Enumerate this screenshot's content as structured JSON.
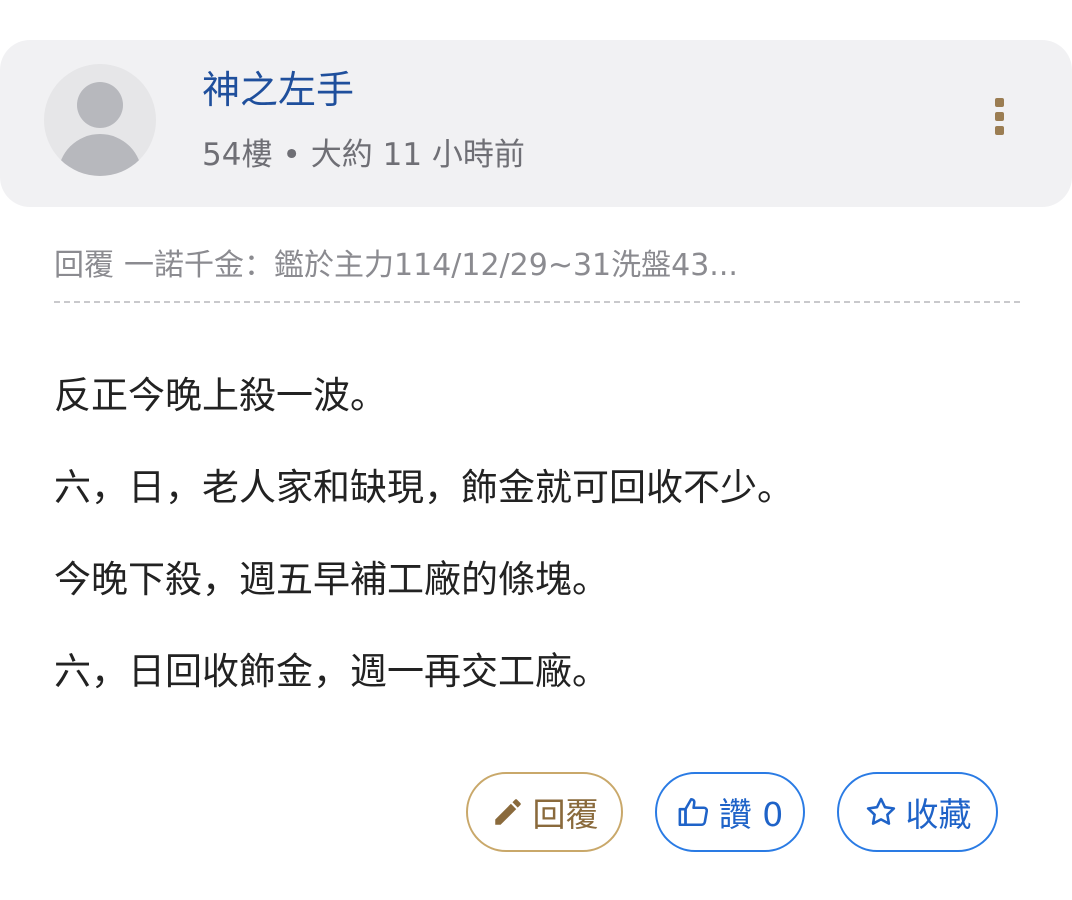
{
  "post": {
    "author": "神之左手",
    "floor": "54樓",
    "meta_separator": "•",
    "time": "大約 11 小時前",
    "quote_prefix": "回覆",
    "quote_text": "一諾千金：鑑於主力114/12/29~31洗盤43...",
    "content_lines": [
      "反正今晚上殺一波。",
      "六，日，老人家和缺現，飾金就可回收不少。",
      "今晚下殺，週五早補工廠的條塊。",
      "六，日回收飾金，週一再交工廠。"
    ]
  },
  "actions": {
    "reply_label": "回覆",
    "like_label": "讚 0",
    "favorite_label": "收藏"
  },
  "icons": {
    "avatar": "default-avatar-icon",
    "more": "more-vertical-icon",
    "reply": "pencil-icon",
    "like": "thumbs-up-icon",
    "favorite": "star-icon"
  },
  "colors": {
    "author_name": "#1f4f9c",
    "header_background": "#f1f1f3",
    "reply_accent": "#c9a86a",
    "action_accent": "#2a7be4",
    "more_icon": "#9b7d52"
  }
}
